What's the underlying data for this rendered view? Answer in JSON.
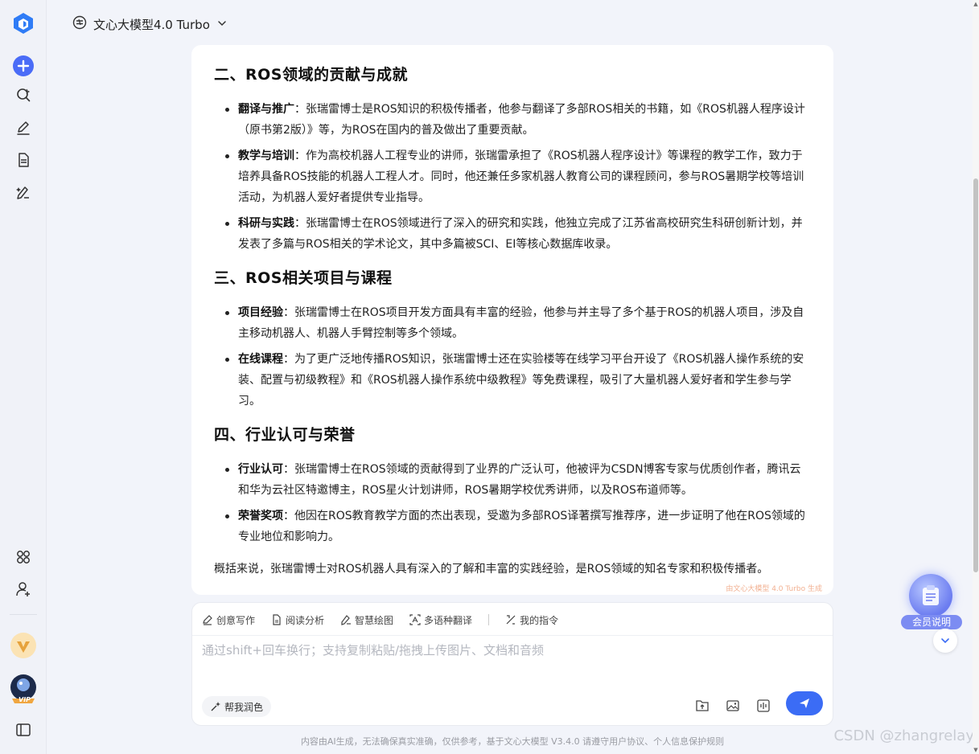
{
  "model": {
    "name": "文心大模型4.0 Turbo"
  },
  "sections": [
    {
      "heading": "二、ROS领域的贡献与成就",
      "items": [
        {
          "term": "翻译与推广",
          "text": "：张瑞雷博士是ROS知识的积极传播者，他参与翻译了多部ROS相关的书籍，如《ROS机器人程序设计（原书第2版）》等，为ROS在国内的普及做出了重要贡献。"
        },
        {
          "term": "教学与培训",
          "text": "：作为高校机器人工程专业的讲师，张瑞雷承担了《ROS机器人程序设计》等课程的教学工作，致力于培养具备ROS技能的机器人工程人才。同时，他还兼任多家机器人教育公司的课程顾问，参与ROS暑期学校等培训活动，为机器人爱好者提供专业指导。"
        },
        {
          "term": "科研与实践",
          "text": "：张瑞雷博士在ROS领域进行了深入的研究和实践，他独立完成了江苏省高校研究生科研创新计划，并发表了多篇与ROS相关的学术论文，其中多篇被SCI、EI等核心数据库收录。"
        }
      ]
    },
    {
      "heading": "三、ROS相关项目与课程",
      "items": [
        {
          "term": "项目经验",
          "text": "：张瑞雷博士在ROS项目开发方面具有丰富的经验，他参与并主导了多个基于ROS的机器人项目，涉及自主移动机器人、机器人手臂控制等多个领域。"
        },
        {
          "term": "在线课程",
          "text": "：为了更广泛地传播ROS知识，张瑞雷博士还在实验楼等在线学习平台开设了《ROS机器人操作系统的安装、配置与初级教程》和《ROS机器人操作系统中级教程》等免费课程，吸引了大量机器人爱好者和学生参与学习。"
        }
      ]
    },
    {
      "heading": "四、行业认可与荣誉",
      "items": [
        {
          "term": "行业认可",
          "text": "：张瑞雷博士在ROS领域的贡献得到了业界的广泛认可，他被评为CSDN博客专家与优质创作者，腾讯云和华为云社区特邀博主，ROS星火计划讲师，ROS暑期学校优秀讲师，以及ROS布道师等。"
        },
        {
          "term": "荣誉奖项",
          "text": "：他因在ROS教育教学方面的杰出表现，受邀为多部ROS译著撰写推荐序，进一步证明了他在ROS领域的专业地位和影响力。"
        }
      ]
    }
  ],
  "summary": "概括来说，张瑞雷博士对ROS机器人具有深入的了解和丰富的实践经验，是ROS领域的知名专家和积极传播者。",
  "generated_by": "由文心大模型 4.0 Turbo 生成",
  "toolbar": {
    "creative_writing": "创意写作",
    "reading_analysis": "阅读分析",
    "smart_drawing": "智慧绘图",
    "translation": "多语种翻译",
    "my_commands": "我的指令"
  },
  "input": {
    "placeholder": "通过shift+回车换行；支持复制粘贴/拖拽上传图片、文档和音频",
    "polish_label": "帮我润色"
  },
  "member": {
    "label": "会员说明"
  },
  "footer": {
    "disclaimer": "内容由AI生成，无法确保真实准确，仅供参考，基于文心大模型 V3.4.0 请遵守用户协议、个人信息保护规则"
  },
  "watermark": "CSDN @zhangrelay",
  "badge": "VIP",
  "colors": {
    "accent": "#3b6cf5",
    "brand": "#2f7cf6",
    "member": "#7c8cf2"
  },
  "icons": [
    "app-logo-icon",
    "new-chat-icon",
    "search-icon",
    "edit-icon",
    "document-icon",
    "draw-icon",
    "apps-icon",
    "add-user-icon",
    "vip-icon",
    "avatar",
    "sidebar-toggle-icon",
    "upload-icon",
    "image-icon",
    "audio-icon",
    "send-icon",
    "chevron-down-icon"
  ]
}
